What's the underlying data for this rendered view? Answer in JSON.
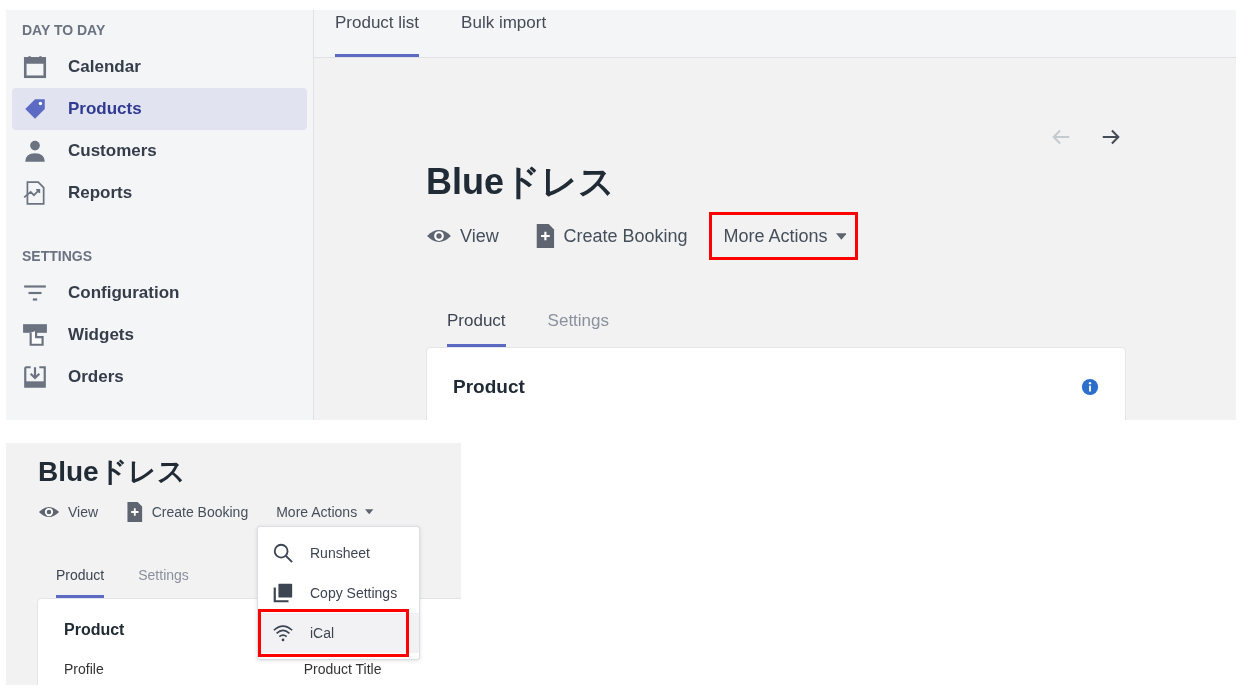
{
  "top_view": {
    "sidebar": {
      "sections": [
        {
          "heading": "DAY TO DAY",
          "items": [
            {
              "label": "Calendar",
              "selected": false
            },
            {
              "label": "Products",
              "selected": true
            },
            {
              "label": "Customers",
              "selected": false
            },
            {
              "label": "Reports",
              "selected": false
            }
          ]
        },
        {
          "heading": "SETTINGS",
          "items": [
            {
              "label": "Configuration",
              "selected": false
            },
            {
              "label": "Widgets",
              "selected": false
            },
            {
              "label": "Orders",
              "selected": false
            }
          ]
        }
      ]
    },
    "tabs": [
      {
        "label": "Product list",
        "selected": true
      },
      {
        "label": "Bulk import",
        "selected": false
      }
    ],
    "pager": {
      "previous": {
        "disabled": true
      },
      "next": {
        "disabled": false
      }
    },
    "title": "Blueドレス",
    "actions": [
      {
        "label": "View",
        "kind": "link"
      },
      {
        "label": "Create Booking",
        "kind": "link"
      },
      {
        "label": "More Actions",
        "kind": "dropdown",
        "highlighted": true
      }
    ],
    "subtabs": [
      {
        "label": "Product",
        "selected": true
      },
      {
        "label": "Settings",
        "selected": false
      }
    ],
    "card": {
      "title": "Product"
    }
  },
  "bottom_view": {
    "title": "Blueドレス",
    "actions": [
      {
        "label": "View",
        "kind": "link"
      },
      {
        "label": "Create Booking",
        "kind": "link"
      },
      {
        "label": "More Actions",
        "kind": "dropdown"
      }
    ],
    "subtabs": [
      {
        "label": "Product",
        "selected": true
      },
      {
        "label": "Settings",
        "selected": false
      }
    ],
    "card": {
      "title": "Product",
      "labels": [
        "Profile",
        "Product Title"
      ]
    },
    "menu": {
      "items": [
        {
          "label": "Runsheet",
          "hovered": false
        },
        {
          "label": "Copy Settings",
          "hovered": false
        },
        {
          "label": "iCal",
          "hovered": true,
          "highlighted": true
        }
      ]
    }
  }
}
